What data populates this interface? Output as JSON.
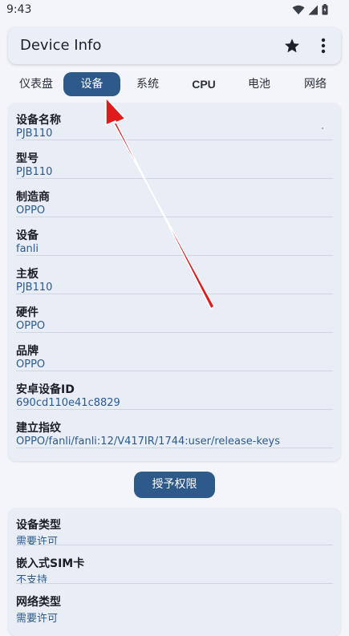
{
  "status_bar": {
    "time": "9:43"
  },
  "app_bar": {
    "title": "Device Info"
  },
  "tabs": [
    {
      "label": "仪表盘"
    },
    {
      "label": "设备"
    },
    {
      "label": "系统"
    },
    {
      "label": "CPU"
    },
    {
      "label": "电池"
    },
    {
      "label": "网络"
    }
  ],
  "active_tab": "设备",
  "device_card": {
    "rows": [
      {
        "label": "设备名称",
        "value": "PJB110"
      },
      {
        "label": "型号",
        "value": "PJB110"
      },
      {
        "label": "制造商",
        "value": "OPPO"
      },
      {
        "label": "设备",
        "value": "fanli"
      },
      {
        "label": "主板",
        "value": "PJB110"
      },
      {
        "label": "硬件",
        "value": "OPPO"
      },
      {
        "label": "品牌",
        "value": "OPPO"
      },
      {
        "label": "安卓设备ID",
        "value": "690cd110e41c8829"
      },
      {
        "label": "建立指纹",
        "value": "OPPO/fanli/fanli:12/V417IR/1744:user/release-keys"
      }
    ]
  },
  "grant_button": {
    "label": "授予权限"
  },
  "sim_card": {
    "rows": [
      {
        "label": "设备类型",
        "value": "需要许可"
      },
      {
        "label": "嵌入式SIM卡",
        "value": "不支持"
      },
      {
        "label": "网络类型",
        "value": "需要许可"
      }
    ]
  },
  "colors": {
    "accent": "#2e5a8a",
    "value_text": "#2c5a8c",
    "annotation_arrow": "#e01b1b"
  }
}
